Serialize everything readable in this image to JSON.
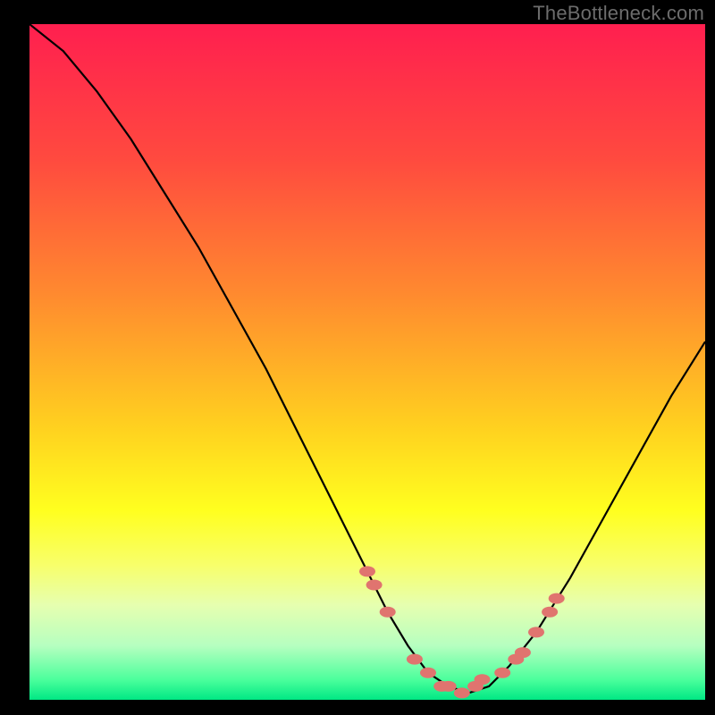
{
  "attribution": "TheBottleneck.com",
  "chart_data": {
    "type": "line",
    "title": "",
    "xlabel": "",
    "ylabel": "",
    "xlim": [
      0,
      100
    ],
    "ylim": [
      0,
      100
    ],
    "curve": {
      "x": [
        0,
        5,
        10,
        15,
        20,
        25,
        30,
        35,
        40,
        45,
        50,
        53,
        56,
        59,
        62,
        65,
        68,
        71,
        75,
        80,
        85,
        90,
        95,
        100
      ],
      "values": [
        100,
        96,
        90,
        83,
        75,
        67,
        58,
        49,
        39,
        29,
        19,
        13,
        8,
        4,
        2,
        1,
        2,
        5,
        10,
        18,
        27,
        36,
        45,
        53
      ]
    },
    "markers": {
      "x": [
        50,
        51,
        53,
        57,
        59,
        61,
        62,
        64,
        66,
        67,
        70,
        72,
        73,
        75,
        77,
        78
      ],
      "values": [
        19,
        17,
        13,
        6,
        4,
        2,
        2,
        1,
        2,
        3,
        4,
        6,
        7,
        10,
        13,
        15
      ]
    },
    "gradient_stops": [
      {
        "offset": 0.0,
        "color": "#ff1f4f"
      },
      {
        "offset": 0.2,
        "color": "#ff4a3f"
      },
      {
        "offset": 0.4,
        "color": "#ff8a2f"
      },
      {
        "offset": 0.6,
        "color": "#ffd21f"
      },
      {
        "offset": 0.72,
        "color": "#ffff1f"
      },
      {
        "offset": 0.8,
        "color": "#f8ff6a"
      },
      {
        "offset": 0.86,
        "color": "#e6ffb0"
      },
      {
        "offset": 0.92,
        "color": "#b6ffc0"
      },
      {
        "offset": 0.97,
        "color": "#4cff9c"
      },
      {
        "offset": 1.0,
        "color": "#00e884"
      }
    ],
    "marker_color": "#e0746f",
    "line_color": "#000000"
  }
}
